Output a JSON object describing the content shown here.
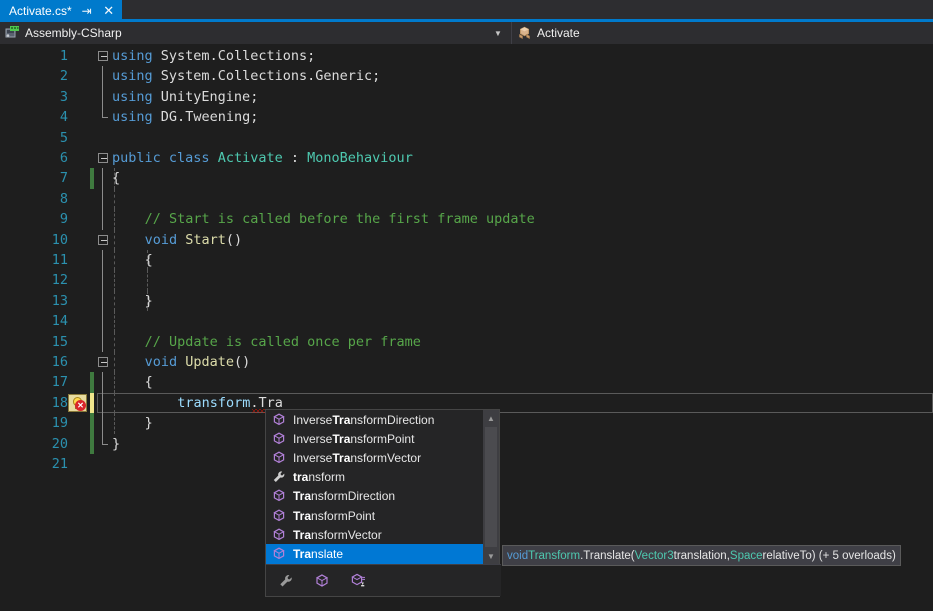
{
  "tab": {
    "title": "Activate.cs*",
    "pin_icon": "pin-icon",
    "close_icon": "close-icon"
  },
  "navbar": {
    "project": "Assembly-CSharp",
    "project_icon": "project-icon",
    "member": "Activate",
    "member_icon": "class-icon",
    "dropdown_arrow": "▾"
  },
  "editor": {
    "lines": [
      {
        "n": "1",
        "indent": 0,
        "text": "using System.Collections;"
      },
      {
        "n": "2",
        "indent": 0,
        "text": "using System.Collections.Generic;"
      },
      {
        "n": "3",
        "indent": 0,
        "text": "using UnityEngine;"
      },
      {
        "n": "4",
        "indent": 0,
        "text": "using DG.Tweening;"
      },
      {
        "n": "5",
        "indent": 0,
        "text": ""
      },
      {
        "n": "6",
        "indent": 0,
        "text": "public class Activate : MonoBehaviour"
      },
      {
        "n": "7",
        "indent": 0,
        "text": "{"
      },
      {
        "n": "8",
        "indent": 0,
        "text": ""
      },
      {
        "n": "9",
        "indent": 1,
        "text": "// Start is called before the first frame update"
      },
      {
        "n": "10",
        "indent": 1,
        "text": "void Start()"
      },
      {
        "n": "11",
        "indent": 1,
        "text": "{"
      },
      {
        "n": "12",
        "indent": 1,
        "text": ""
      },
      {
        "n": "13",
        "indent": 1,
        "text": "}"
      },
      {
        "n": "14",
        "indent": 0,
        "text": ""
      },
      {
        "n": "15",
        "indent": 1,
        "text": "// Update is called once per frame"
      },
      {
        "n": "16",
        "indent": 1,
        "text": "void Update()"
      },
      {
        "n": "17",
        "indent": 1,
        "text": "{"
      },
      {
        "n": "18",
        "indent": 2,
        "text": "transform.Tra"
      },
      {
        "n": "19",
        "indent": 1,
        "text": "}"
      },
      {
        "n": "20",
        "indent": 0,
        "text": "}"
      },
      {
        "n": "21",
        "indent": 0,
        "text": ""
      }
    ],
    "caret_line": "18",
    "error_glyph": "error-lightbulb-icon",
    "colors": {
      "keyword": "#569cd6",
      "type": "#4ec9b0",
      "comment": "#57a64a",
      "method": "#dcdcaa",
      "field": "#9cdcfe",
      "plain": "#dcdcdc",
      "background": "#1e1e1e",
      "linenumber": "#2b91af",
      "change_added": "#3f7a3f",
      "change_unsaved": "#f0e68c",
      "error_squiggle": "#e51400"
    }
  },
  "intellisense": {
    "items": [
      {
        "label": "InverseTransformDirection",
        "match": "Tra",
        "match_start": 7,
        "icon": "method-icon",
        "selected": false
      },
      {
        "label": "InverseTransformPoint",
        "match": "Tra",
        "match_start": 7,
        "icon": "method-icon",
        "selected": false
      },
      {
        "label": "InverseTransformVector",
        "match": "Tra",
        "match_start": 7,
        "icon": "method-icon",
        "selected": false
      },
      {
        "label": "transform",
        "match": "tra",
        "match_start": 0,
        "icon": "property-icon",
        "selected": false
      },
      {
        "label": "TransformDirection",
        "match": "Tra",
        "match_start": 0,
        "icon": "method-icon",
        "selected": false
      },
      {
        "label": "TransformPoint",
        "match": "Tra",
        "match_start": 0,
        "icon": "method-icon",
        "selected": false
      },
      {
        "label": "TransformVector",
        "match": "Tra",
        "match_start": 0,
        "icon": "method-icon",
        "selected": false
      },
      {
        "label": "Translate",
        "match": "Tra",
        "match_start": 0,
        "icon": "method-icon",
        "selected": true
      }
    ],
    "selected_label": "Translate",
    "selection_color": "#0078d4",
    "filters": [
      {
        "name": "filter-properties-icon"
      },
      {
        "name": "filter-methods-icon"
      },
      {
        "name": "filter-extension-methods-icon"
      }
    ],
    "scrollbar": {
      "up_arrow": "▲",
      "down_arrow": "▼"
    }
  },
  "signature_tooltip": {
    "segments": [
      {
        "t": "void ",
        "c": "keyword"
      },
      {
        "t": "Transform",
        "c": "type"
      },
      {
        "t": ".Translate(",
        "c": "plain"
      },
      {
        "t": "Vector3",
        "c": "type"
      },
      {
        "t": " translation, ",
        "c": "plain"
      },
      {
        "t": "Space",
        "c": "type"
      },
      {
        "t": " relativeTo) (+ 5 overloads)",
        "c": "plain"
      }
    ],
    "full_text": "void Transform.Translate(Vector3 translation, Space relativeTo) (+ 5 overloads)"
  }
}
